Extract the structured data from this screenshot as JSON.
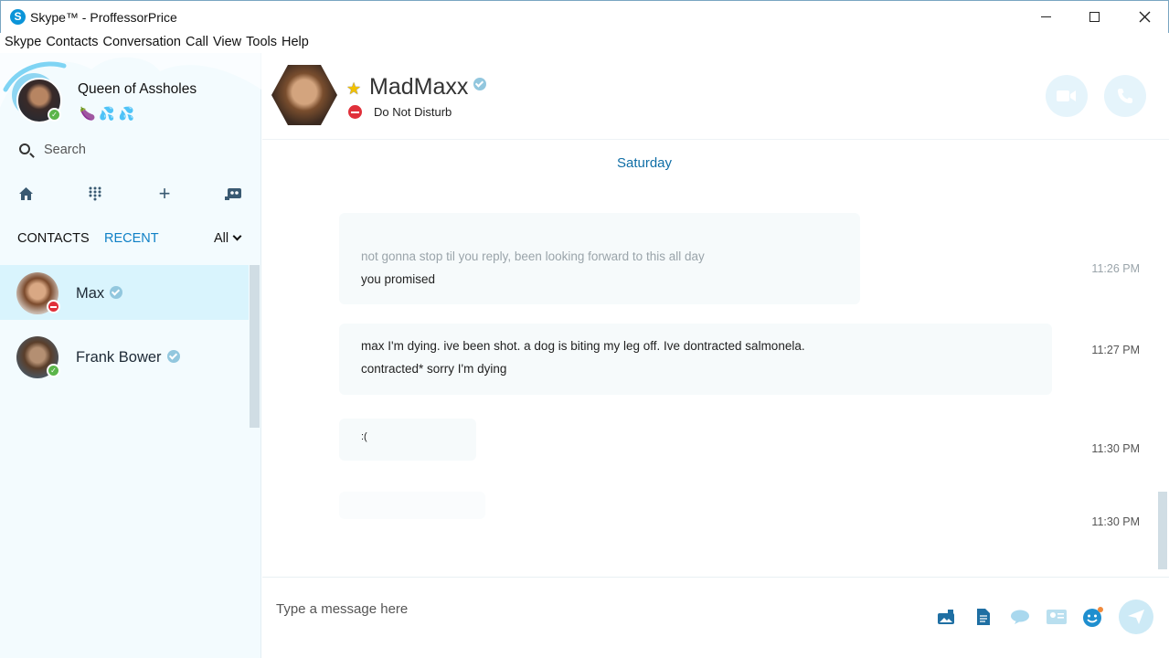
{
  "window": {
    "title": "Skype™ - ProffessorPrice",
    "app_logo_letter": "S"
  },
  "menu": [
    "Skype",
    "Contacts",
    "Conversation",
    "Call",
    "View",
    "Tools",
    "Help"
  ],
  "profile": {
    "name": "Queen of Assholes",
    "mood": "🍆💦💦",
    "status": "online"
  },
  "search": {
    "placeholder": "Search"
  },
  "tabs": {
    "contacts": "CONTACTS",
    "recent": "RECENT",
    "filter": "All"
  },
  "contacts": [
    {
      "name": "Max",
      "status": "do-not-disturb",
      "selected": true
    },
    {
      "name": "Frank Bower",
      "status": "online",
      "selected": false
    }
  ],
  "conversation": {
    "contact_name": "MadMaxx",
    "status": "Do Not Disturb",
    "favorite": true,
    "day": "Saturday",
    "messages": [
      {
        "lines": [
          "not gonna stop til you reply, been looking forward to this all day",
          "you promised"
        ],
        "time": "11:26 PM"
      },
      {
        "lines": [
          "max I'm dying. ive been shot. a dog is biting my leg off. Ive dontracted salmonela.",
          "contracted* sorry I'm dying"
        ],
        "time": "11:27 PM"
      },
      {
        "lines": [
          ":("
        ],
        "time": "11:30 PM"
      },
      {
        "lines": [],
        "time": "11:30 PM"
      }
    ]
  },
  "composer": {
    "placeholder": "Type a message here"
  },
  "colors": {
    "accent": "#0f80c6",
    "online": "#5bb54a",
    "dnd": "#e0303a",
    "selected_row": "#d9f4fd",
    "sidebar_bg": "#f3fbfe"
  }
}
